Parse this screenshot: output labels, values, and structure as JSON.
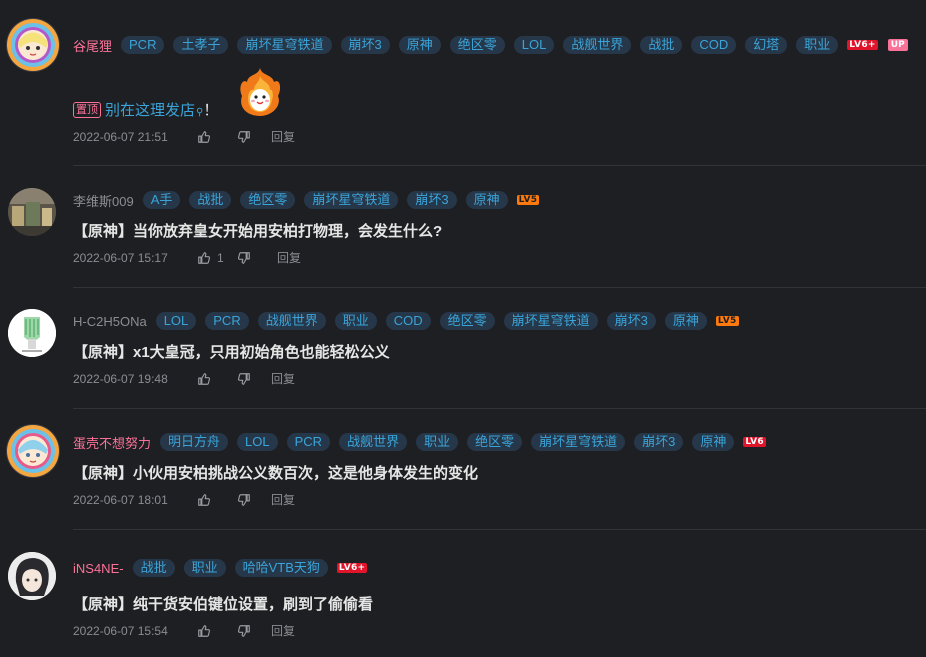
{
  "comments": [
    {
      "username": "谷尾狸",
      "tags": [
        "PCR",
        "土孝子",
        "崩坏星穹铁道",
        "崩坏3",
        "原神",
        "绝区零",
        "LOL",
        "战舰世界",
        "战批",
        "COD",
        "幻塔",
        "职业"
      ],
      "level": "LV6+",
      "up_badge": "UP",
      "pin_label": "置顶",
      "content_link": "别在这理发店",
      "content_suffix": "！",
      "time": "2022-06-07 21:51",
      "likes": "",
      "reply_label": "回复"
    },
    {
      "username": "李维斯009",
      "tags": [
        "A手",
        "战批",
        "绝区零",
        "崩坏星穹铁道",
        "崩坏3",
        "原神"
      ],
      "level": "LV5",
      "content": "【原神】当你放弃皇女开始用安柏打物理，会发生什么?",
      "time": "2022-06-07 15:17",
      "likes": "1",
      "reply_label": "回复"
    },
    {
      "username": "H-C2H5ONa",
      "tags": [
        "LOL",
        "PCR",
        "战舰世界",
        "职业",
        "COD",
        "绝区零",
        "崩坏星穹铁道",
        "崩坏3",
        "原神"
      ],
      "level": "LV5",
      "content": "【原神】x1大皇冠，只用初始角色也能轻松公义",
      "time": "2022-06-07 19:48",
      "likes": "",
      "reply_label": "回复"
    },
    {
      "username": "蛋壳不想努力",
      "tags": [
        "明日方舟",
        "LOL",
        "PCR",
        "战舰世界",
        "职业",
        "绝区零",
        "崩坏星穹铁道",
        "崩坏3",
        "原神"
      ],
      "level": "LV6",
      "content": "【原神】小伙用安柏挑战公义数百次，这是他身体发生的变化",
      "time": "2022-06-07 18:01",
      "likes": "",
      "reply_label": "回复"
    },
    {
      "username": "iNS4NE-",
      "tags": [
        "战批",
        "职业",
        "哈哈VTB天狗"
      ],
      "level": "LV6+",
      "content": "【原神】纯干货安伯键位设置，刷到了偷偷看",
      "time": "2022-06-07 15:54",
      "likes": "",
      "reply_label": "回复"
    }
  ],
  "icons": {
    "like": "thumbs-up-icon",
    "dislike": "thumbs-down-icon",
    "search": "search-icon"
  },
  "colors": {
    "background": "#1e1f22",
    "vip_name": "#fb7299",
    "tag_text": "#3aa4d8",
    "tag_bg": "#27374a",
    "level6": "#e0142b",
    "level5": "#ff7a0e"
  }
}
